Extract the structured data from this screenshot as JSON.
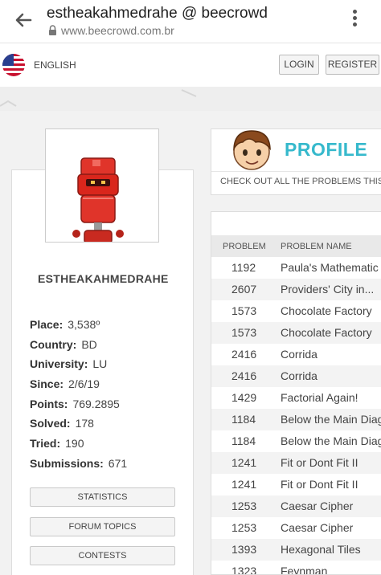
{
  "browser": {
    "title": "estheakahmedrahe @ beecrowd",
    "url": "www.beecrowd.com.br"
  },
  "header": {
    "language": "ENGLISH",
    "login": "LOGIN",
    "register": "REGISTER"
  },
  "profile": {
    "username": "ESTHEAKAHMEDRAHE",
    "stats": [
      {
        "label": "Place:",
        "value": "3,538º"
      },
      {
        "label": "Country:",
        "value": "BD"
      },
      {
        "label": "University:",
        "value": "LU"
      },
      {
        "label": "Since:",
        "value": "2/6/19"
      },
      {
        "label": "Points:",
        "value": "769.2895"
      },
      {
        "label": "Solved:",
        "value": "178"
      },
      {
        "label": "Tried:",
        "value": "190"
      },
      {
        "label": "Submissions:",
        "value": "671"
      }
    ],
    "buttons": [
      "STATISTICS",
      "FORUM TOPICS",
      "CONTESTS"
    ]
  },
  "banner": {
    "heading": "PROFILE",
    "subtitle": "CHECK OUT ALL THE PROBLEMS THIS U"
  },
  "table": {
    "columns": [
      "PROBLEM",
      "PROBLEM NAME"
    ],
    "rows": [
      {
        "id": "1192",
        "name": "Paula's Mathematic G"
      },
      {
        "id": "2607",
        "name": "Providers' City in..."
      },
      {
        "id": "1573",
        "name": "Chocolate Factory"
      },
      {
        "id": "1573",
        "name": "Chocolate Factory"
      },
      {
        "id": "2416",
        "name": "Corrida"
      },
      {
        "id": "2416",
        "name": "Corrida"
      },
      {
        "id": "1429",
        "name": "Factorial Again!"
      },
      {
        "id": "1184",
        "name": "Below the Main Diag"
      },
      {
        "id": "1184",
        "name": "Below the Main Diag"
      },
      {
        "id": "1241",
        "name": "Fit or Dont Fit II"
      },
      {
        "id": "1241",
        "name": "Fit or Dont Fit II"
      },
      {
        "id": "1253",
        "name": "Caesar Cipher"
      },
      {
        "id": "1253",
        "name": "Caesar Cipher"
      },
      {
        "id": "1393",
        "name": "Hexagonal Tiles"
      },
      {
        "id": "1323",
        "name": "Feynman"
      }
    ]
  },
  "colors": {
    "accent": "#36b9cc",
    "robot": "#d9261c"
  }
}
